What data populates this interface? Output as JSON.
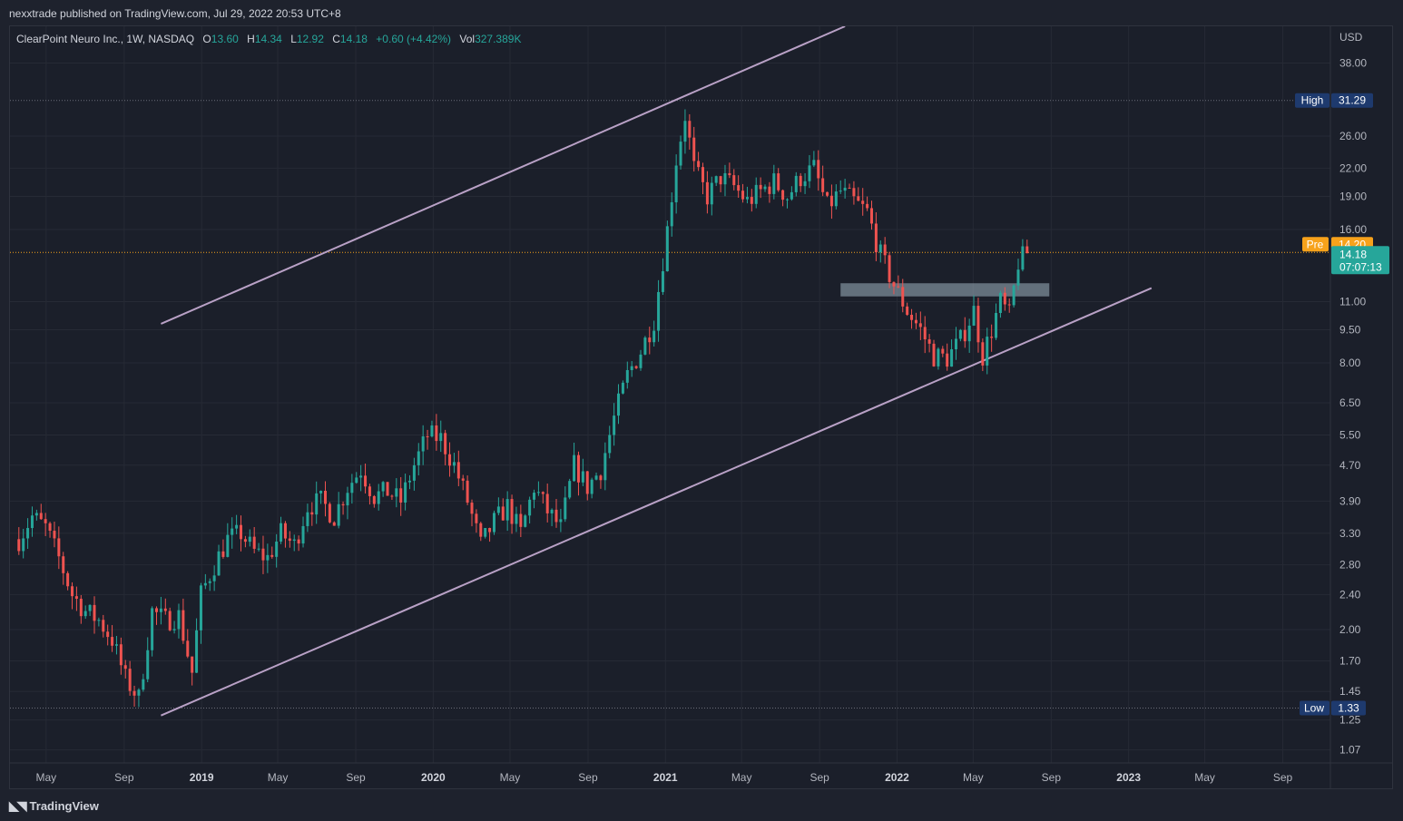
{
  "header": {
    "published": "nexxtrade published on TradingView.com, Jul 29, 2022 20:53 UTC+8"
  },
  "legend": {
    "symbol": "ClearPoint Neuro Inc., 1W, NASDAQ",
    "o_label": "O",
    "o_value": "13.60",
    "h_label": "H",
    "h_value": "14.34",
    "l_label": "L",
    "l_value": "12.92",
    "c_label": "C",
    "c_value": "14.18",
    "change": "+0.60 (+4.42%)",
    "vol_label": "Vol",
    "vol_value": "327.389K"
  },
  "footer": {
    "brand": "TradingView",
    "logo_icon": "tradingview-logo-icon"
  },
  "colors": {
    "up": "#26a69a",
    "down": "#ef5350",
    "trendline": "#b9a1c6",
    "zone": "#9fb3bf",
    "price_line": "#f7a21b"
  },
  "chart_data": {
    "type": "candlestick",
    "currency": "USD",
    "scale": "log",
    "ylim": [
      1.0,
      46.0
    ],
    "y_ticks": [
      "38.00",
      "26.00",
      "22.00",
      "19.00",
      "16.00",
      "11.00",
      "9.50",
      "8.00",
      "6.50",
      "5.50",
      "4.70",
      "3.90",
      "3.30",
      "2.80",
      "2.40",
      "2.00",
      "1.70",
      "1.45",
      "1.25",
      "1.07"
    ],
    "x_ticks": [
      {
        "label": "May",
        "date": "2018-05-01",
        "bold": false
      },
      {
        "label": "Sep",
        "date": "2018-09-01",
        "bold": false
      },
      {
        "label": "2019",
        "date": "2019-01-01",
        "bold": true
      },
      {
        "label": "May",
        "date": "2019-05-01",
        "bold": false
      },
      {
        "label": "Sep",
        "date": "2019-09-01",
        "bold": false
      },
      {
        "label": "2020",
        "date": "2020-01-01",
        "bold": true
      },
      {
        "label": "May",
        "date": "2020-05-01",
        "bold": false
      },
      {
        "label": "Sep",
        "date": "2020-09-01",
        "bold": false
      },
      {
        "label": "2021",
        "date": "2021-01-01",
        "bold": true
      },
      {
        "label": "May",
        "date": "2021-05-01",
        "bold": false
      },
      {
        "label": "Sep",
        "date": "2021-09-01",
        "bold": false
      },
      {
        "label": "2022",
        "date": "2022-01-01",
        "bold": true
      },
      {
        "label": "May",
        "date": "2022-05-01",
        "bold": false
      },
      {
        "label": "Sep",
        "date": "2022-09-01",
        "bold": false
      },
      {
        "label": "2023",
        "date": "2023-01-01",
        "bold": true
      },
      {
        "label": "May",
        "date": "2023-05-01",
        "bold": false
      },
      {
        "label": "Sep",
        "date": "2023-09-01",
        "bold": false
      }
    ],
    "high": {
      "label": "High",
      "value": "31.29"
    },
    "low": {
      "label": "Low",
      "value": "1.33"
    },
    "pre": {
      "label": "Pre",
      "value": "14.20"
    },
    "last": {
      "value": "14.18",
      "countdown": "07:07:13"
    },
    "trendlines": [
      {
        "name": "upper-channel",
        "points": [
          [
            "2018-10-29",
            9.8
          ],
          [
            "2021-10-11",
            46.0
          ]
        ]
      },
      {
        "name": "lower-channel",
        "points": [
          [
            "2018-10-29",
            1.28
          ],
          [
            "2023-02-06",
            11.8
          ]
        ]
      }
    ],
    "zone": {
      "start": "2021-10-04",
      "end": "2022-08-29",
      "low": 11.3,
      "high": 12.1
    },
    "series": [
      {
        "points": [
          [
            "2018-03-19",
            3.2
          ],
          [
            "2018-04-09",
            3.6
          ],
          [
            "2018-04-30",
            3.4
          ],
          [
            "2018-05-21",
            2.9
          ],
          [
            "2018-06-11",
            2.4
          ],
          [
            "2018-07-02",
            2.2
          ],
          [
            "2018-07-23",
            2.1
          ],
          [
            "2018-08-13",
            1.9
          ],
          [
            "2018-09-03",
            1.55
          ],
          [
            "2018-09-24",
            1.4
          ],
          [
            "2018-10-15",
            2.2
          ],
          [
            "2018-11-05",
            2.1
          ],
          [
            "2018-11-26",
            2.15
          ],
          [
            "2018-12-17",
            1.6
          ],
          [
            "2018-12-31",
            2.4
          ],
          [
            "2019-01-21",
            2.8
          ],
          [
            "2019-02-11",
            3.2
          ],
          [
            "2019-03-04",
            3.3
          ],
          [
            "2019-03-25",
            3.0
          ],
          [
            "2019-04-15",
            2.9
          ],
          [
            "2019-05-06",
            3.3
          ],
          [
            "2019-05-27",
            3.1
          ],
          [
            "2019-06-17",
            3.8
          ],
          [
            "2019-07-08",
            3.9
          ],
          [
            "2019-07-29",
            3.6
          ],
          [
            "2019-08-19",
            4.2
          ],
          [
            "2019-09-09",
            4.6
          ],
          [
            "2019-09-30",
            4.0
          ],
          [
            "2019-10-21",
            4.1
          ],
          [
            "2019-11-11",
            3.9
          ],
          [
            "2019-12-02",
            4.7
          ],
          [
            "2019-12-23",
            5.5
          ],
          [
            "2020-01-13",
            5.4
          ],
          [
            "2020-02-03",
            4.7
          ],
          [
            "2020-02-24",
            3.9
          ],
          [
            "2020-03-16",
            3.1
          ],
          [
            "2020-04-06",
            3.5
          ],
          [
            "2020-04-27",
            3.8
          ],
          [
            "2020-05-18",
            3.3
          ],
          [
            "2020-06-08",
            4.2
          ],
          [
            "2020-06-29",
            3.7
          ],
          [
            "2020-07-20",
            3.4
          ],
          [
            "2020-08-10",
            4.7
          ],
          [
            "2020-08-31",
            4.2
          ],
          [
            "2020-09-21",
            4.6
          ],
          [
            "2020-10-12",
            6.0
          ],
          [
            "2020-11-02",
            7.5
          ],
          [
            "2020-11-23",
            8.5
          ],
          [
            "2020-12-14",
            10.0
          ],
          [
            "2021-01-04",
            16.0
          ],
          [
            "2021-01-18",
            23.0
          ],
          [
            "2021-02-01",
            29.0
          ],
          [
            "2021-02-15",
            22.0
          ],
          [
            "2021-03-08",
            19.0
          ],
          [
            "2021-03-29",
            21.0
          ],
          [
            "2021-04-19",
            20.0
          ],
          [
            "2021-05-10",
            18.5
          ],
          [
            "2021-05-31",
            19.5
          ],
          [
            "2021-06-21",
            20.5
          ],
          [
            "2021-07-12",
            19.0
          ],
          [
            "2021-08-02",
            21.0
          ],
          [
            "2021-08-23",
            22.0
          ],
          [
            "2021-09-13",
            18.0
          ],
          [
            "2021-10-04",
            19.5
          ],
          [
            "2021-10-25",
            18.5
          ],
          [
            "2021-11-15",
            17.5
          ],
          [
            "2021-12-06",
            14.0
          ],
          [
            "2021-12-27",
            12.0
          ],
          [
            "2022-01-17",
            10.5
          ],
          [
            "2022-02-07",
            9.5
          ],
          [
            "2022-02-28",
            8.3
          ],
          [
            "2022-03-21",
            8.2
          ],
          [
            "2022-04-11",
            9.0
          ],
          [
            "2022-05-02",
            10.5
          ],
          [
            "2022-05-16",
            8.3
          ],
          [
            "2022-05-30",
            9.5
          ],
          [
            "2022-06-13",
            11.0
          ],
          [
            "2022-06-27",
            10.2
          ],
          [
            "2022-07-11",
            13.5
          ],
          [
            "2022-07-25",
            14.18
          ]
        ]
      }
    ]
  }
}
